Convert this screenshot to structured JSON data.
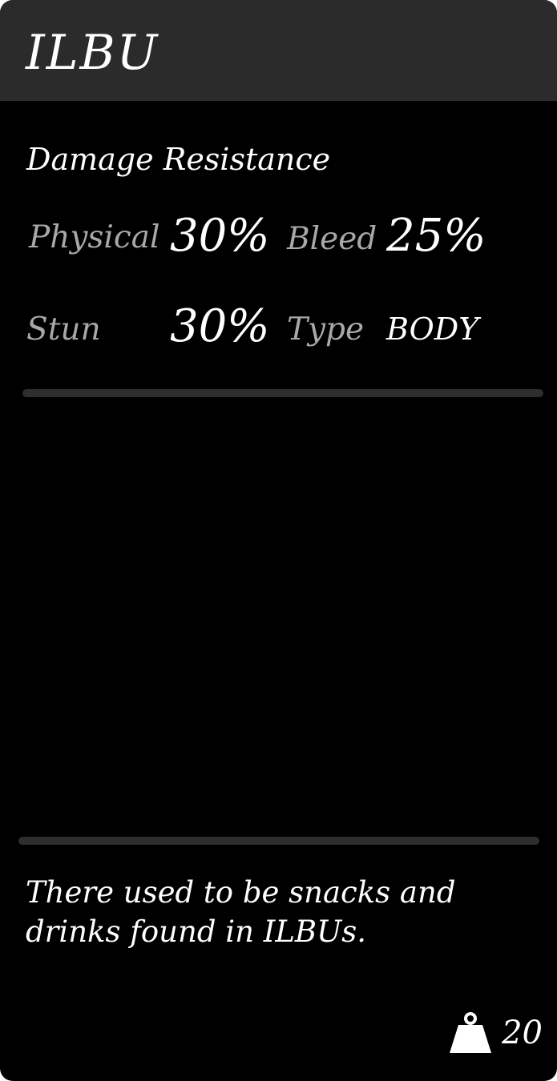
{
  "item": {
    "name": "ILBU"
  },
  "damage_resistance": {
    "heading": "Damage Resistance",
    "physical_label": "Physical",
    "physical_value": "30%",
    "bleed_label": "Bleed",
    "bleed_value": "25%",
    "stun_label": "Stun",
    "stun_value": "30%",
    "type_label": "Type",
    "type_value": "BODY"
  },
  "description": "There used to be snacks and drinks found in ILBUs.",
  "weight": {
    "icon": "weight-icon",
    "value": "20"
  },
  "colors": {
    "card_background": "#000000",
    "header_background": "#2b2b2b",
    "label_gray": "#a8a8a8",
    "divider": "#2e2e2e",
    "text_white": "#ffffff"
  }
}
